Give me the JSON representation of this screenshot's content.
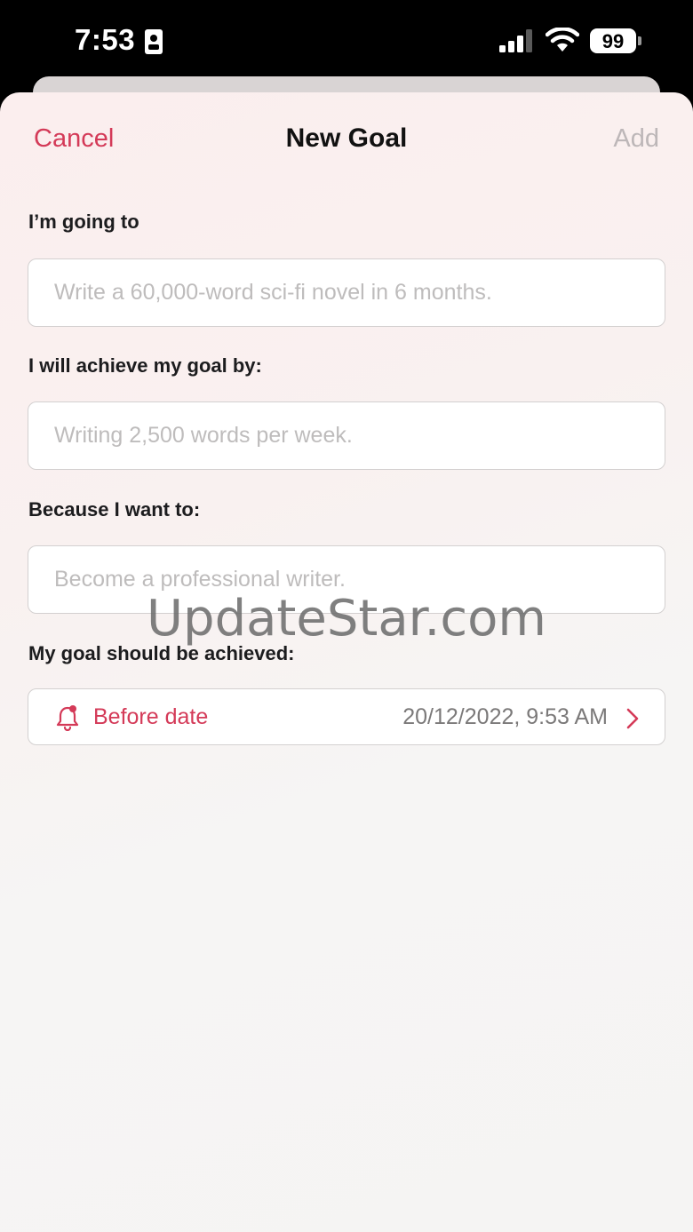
{
  "status_bar": {
    "time": "7:53",
    "battery": "99",
    "icons": [
      "id-card-icon",
      "cellular-signal-icon",
      "wifi-icon",
      "battery-icon"
    ]
  },
  "nav": {
    "cancel": "Cancel",
    "title": "New Goal",
    "add": "Add"
  },
  "form": {
    "goal": {
      "label": "I’m going to",
      "placeholder": "Write a 60,000-word sci-fi novel in 6 months.",
      "value": ""
    },
    "method": {
      "label": "I will achieve my goal by:",
      "placeholder": "Writing 2,500 words per week.",
      "value": ""
    },
    "reason": {
      "label": "Because I want to:",
      "placeholder": "Become a professional writer.",
      "value": ""
    },
    "deadline": {
      "label": "My goal should be achieved:",
      "option": "Before date",
      "value": "20/12/2022, 9:53 AM",
      "icon": "bell-icon"
    }
  },
  "watermark": "UpdateStar.com",
  "colors": {
    "accent": "#d43a58",
    "disabled": "#bdb7b8",
    "placeholder": "#bebcbc"
  }
}
